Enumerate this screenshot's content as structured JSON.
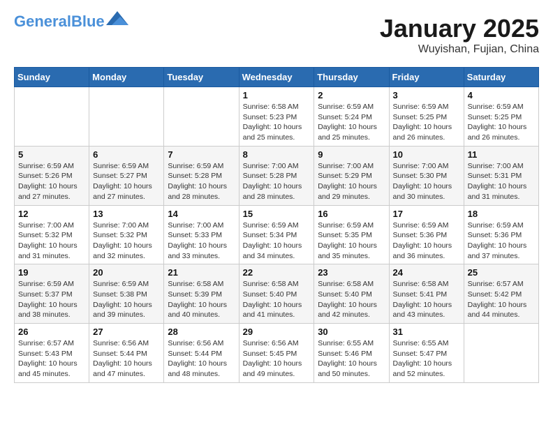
{
  "header": {
    "logo_general": "General",
    "logo_blue": "Blue",
    "month_title": "January 2025",
    "subtitle": "Wuyishan, Fujian, China"
  },
  "days_of_week": [
    "Sunday",
    "Monday",
    "Tuesday",
    "Wednesday",
    "Thursday",
    "Friday",
    "Saturday"
  ],
  "weeks": [
    [
      {
        "day": "",
        "info": ""
      },
      {
        "day": "",
        "info": ""
      },
      {
        "day": "",
        "info": ""
      },
      {
        "day": "1",
        "info": "Sunrise: 6:58 AM\nSunset: 5:23 PM\nDaylight: 10 hours\nand 25 minutes."
      },
      {
        "day": "2",
        "info": "Sunrise: 6:59 AM\nSunset: 5:24 PM\nDaylight: 10 hours\nand 25 minutes."
      },
      {
        "day": "3",
        "info": "Sunrise: 6:59 AM\nSunset: 5:25 PM\nDaylight: 10 hours\nand 26 minutes."
      },
      {
        "day": "4",
        "info": "Sunrise: 6:59 AM\nSunset: 5:25 PM\nDaylight: 10 hours\nand 26 minutes."
      }
    ],
    [
      {
        "day": "5",
        "info": "Sunrise: 6:59 AM\nSunset: 5:26 PM\nDaylight: 10 hours\nand 27 minutes."
      },
      {
        "day": "6",
        "info": "Sunrise: 6:59 AM\nSunset: 5:27 PM\nDaylight: 10 hours\nand 27 minutes."
      },
      {
        "day": "7",
        "info": "Sunrise: 6:59 AM\nSunset: 5:28 PM\nDaylight: 10 hours\nand 28 minutes."
      },
      {
        "day": "8",
        "info": "Sunrise: 7:00 AM\nSunset: 5:28 PM\nDaylight: 10 hours\nand 28 minutes."
      },
      {
        "day": "9",
        "info": "Sunrise: 7:00 AM\nSunset: 5:29 PM\nDaylight: 10 hours\nand 29 minutes."
      },
      {
        "day": "10",
        "info": "Sunrise: 7:00 AM\nSunset: 5:30 PM\nDaylight: 10 hours\nand 30 minutes."
      },
      {
        "day": "11",
        "info": "Sunrise: 7:00 AM\nSunset: 5:31 PM\nDaylight: 10 hours\nand 31 minutes."
      }
    ],
    [
      {
        "day": "12",
        "info": "Sunrise: 7:00 AM\nSunset: 5:32 PM\nDaylight: 10 hours\nand 31 minutes."
      },
      {
        "day": "13",
        "info": "Sunrise: 7:00 AM\nSunset: 5:32 PM\nDaylight: 10 hours\nand 32 minutes."
      },
      {
        "day": "14",
        "info": "Sunrise: 7:00 AM\nSunset: 5:33 PM\nDaylight: 10 hours\nand 33 minutes."
      },
      {
        "day": "15",
        "info": "Sunrise: 6:59 AM\nSunset: 5:34 PM\nDaylight: 10 hours\nand 34 minutes."
      },
      {
        "day": "16",
        "info": "Sunrise: 6:59 AM\nSunset: 5:35 PM\nDaylight: 10 hours\nand 35 minutes."
      },
      {
        "day": "17",
        "info": "Sunrise: 6:59 AM\nSunset: 5:36 PM\nDaylight: 10 hours\nand 36 minutes."
      },
      {
        "day": "18",
        "info": "Sunrise: 6:59 AM\nSunset: 5:36 PM\nDaylight: 10 hours\nand 37 minutes."
      }
    ],
    [
      {
        "day": "19",
        "info": "Sunrise: 6:59 AM\nSunset: 5:37 PM\nDaylight: 10 hours\nand 38 minutes."
      },
      {
        "day": "20",
        "info": "Sunrise: 6:59 AM\nSunset: 5:38 PM\nDaylight: 10 hours\nand 39 minutes."
      },
      {
        "day": "21",
        "info": "Sunrise: 6:58 AM\nSunset: 5:39 PM\nDaylight: 10 hours\nand 40 minutes."
      },
      {
        "day": "22",
        "info": "Sunrise: 6:58 AM\nSunset: 5:40 PM\nDaylight: 10 hours\nand 41 minutes."
      },
      {
        "day": "23",
        "info": "Sunrise: 6:58 AM\nSunset: 5:40 PM\nDaylight: 10 hours\nand 42 minutes."
      },
      {
        "day": "24",
        "info": "Sunrise: 6:58 AM\nSunset: 5:41 PM\nDaylight: 10 hours\nand 43 minutes."
      },
      {
        "day": "25",
        "info": "Sunrise: 6:57 AM\nSunset: 5:42 PM\nDaylight: 10 hours\nand 44 minutes."
      }
    ],
    [
      {
        "day": "26",
        "info": "Sunrise: 6:57 AM\nSunset: 5:43 PM\nDaylight: 10 hours\nand 45 minutes."
      },
      {
        "day": "27",
        "info": "Sunrise: 6:56 AM\nSunset: 5:44 PM\nDaylight: 10 hours\nand 47 minutes."
      },
      {
        "day": "28",
        "info": "Sunrise: 6:56 AM\nSunset: 5:44 PM\nDaylight: 10 hours\nand 48 minutes."
      },
      {
        "day": "29",
        "info": "Sunrise: 6:56 AM\nSunset: 5:45 PM\nDaylight: 10 hours\nand 49 minutes."
      },
      {
        "day": "30",
        "info": "Sunrise: 6:55 AM\nSunset: 5:46 PM\nDaylight: 10 hours\nand 50 minutes."
      },
      {
        "day": "31",
        "info": "Sunrise: 6:55 AM\nSunset: 5:47 PM\nDaylight: 10 hours\nand 52 minutes."
      },
      {
        "day": "",
        "info": ""
      }
    ]
  ]
}
